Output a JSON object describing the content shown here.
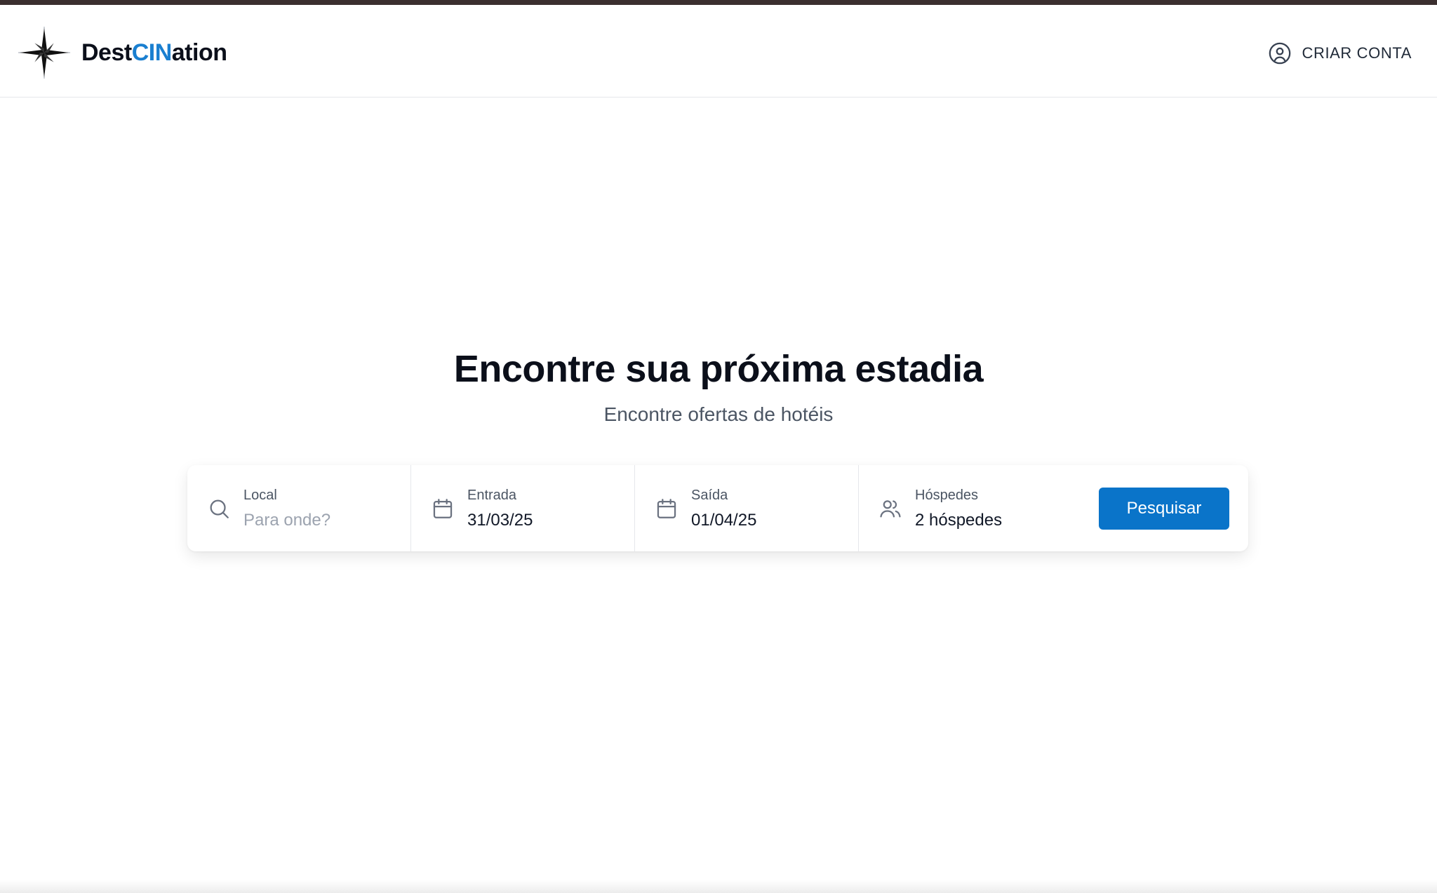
{
  "header": {
    "logo_text_prefix": "Dest",
    "logo_text_accent": "CIN",
    "logo_text_suffix": "ation",
    "account_label": "CRIAR CONTA",
    "account_icon": "user-circle-icon"
  },
  "hero": {
    "title": "Encontre sua próxima estadia",
    "subtitle": "Encontre ofertas de hotéis"
  },
  "search": {
    "location": {
      "label": "Local",
      "placeholder": "Para onde?",
      "value": "",
      "icon": "search-icon"
    },
    "checkin": {
      "label": "Entrada",
      "value": "31/03/25",
      "icon": "calendar-icon"
    },
    "checkout": {
      "label": "Saída",
      "value": "01/04/25",
      "icon": "calendar-icon"
    },
    "guests": {
      "label": "Hóspedes",
      "value": "2 hóspedes",
      "icon": "users-icon"
    },
    "button_label": "Pesquisar"
  },
  "colors": {
    "brand_accent": "#1a7fd0",
    "button": "#0a74c9",
    "top_strip": "#3b2f2f"
  }
}
